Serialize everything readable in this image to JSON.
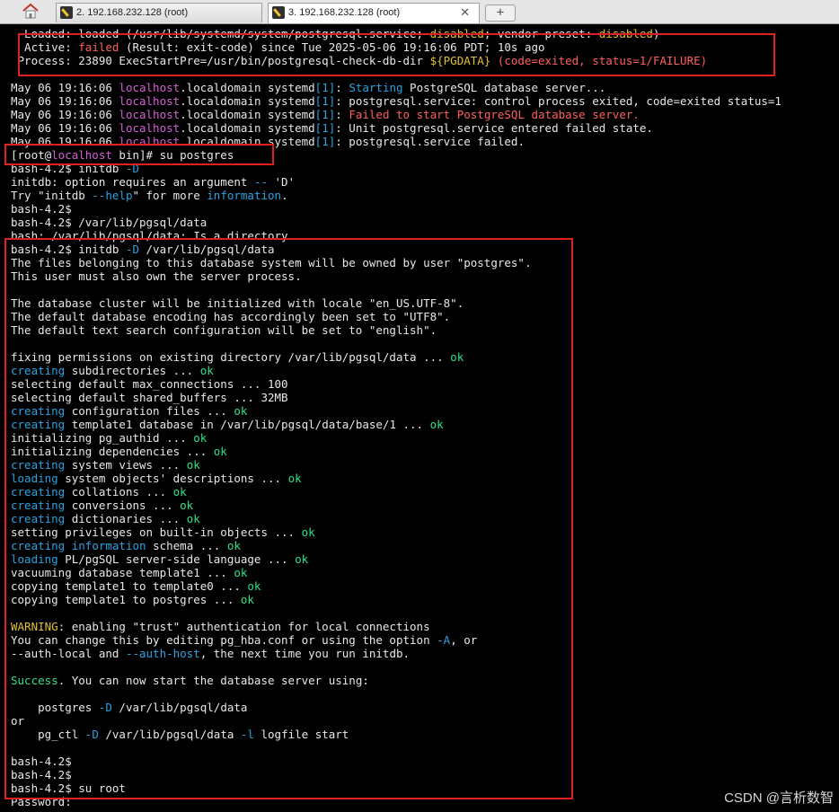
{
  "tabs": [
    {
      "label": "2. 192.168.232.128 (root)"
    },
    {
      "label": "3. 192.168.232.128 (root)",
      "close": "✕"
    }
  ],
  "new_tab": "+",
  "icons": {
    "home": "home-icon",
    "terminal": "terminal-icon"
  },
  "colors": {
    "text": "#e8e8e8",
    "magenta": "#d75fd7",
    "cyan": "#2aa3e0",
    "red": "#ff5f5f",
    "green": "#2ee089",
    "yellow": "#e0c030",
    "highlight_box": "#e0201e"
  },
  "terminal": {
    "lines": [
      [
        [
          "  Loaded: loaded (/usr/lib/systemd/system/postgresql.service; ",
          ""
        ],
        [
          "disabled",
          "yellow"
        ],
        [
          "; vendor preset: ",
          ""
        ],
        [
          "disabled",
          "yellow"
        ],
        [
          ")",
          ""
        ]
      ],
      [
        [
          "  Active: ",
          ""
        ],
        [
          "failed",
          "red"
        ],
        [
          " (Result: exit-code) since Tue 2025-05-06 19:16:06 PDT; 10s ago",
          ""
        ]
      ],
      [
        [
          " Process: 23890 ExecStartPre=/usr/bin/postgresql-check-db-dir ",
          ""
        ],
        [
          "${PGDATA}",
          "yellow"
        ],
        [
          " (code=exited, status=1/FAILURE)",
          "red"
        ]
      ],
      [],
      [
        [
          "May 06 19:16:06 ",
          ""
        ],
        [
          "localhost",
          "magenta"
        ],
        [
          ".localdomain systemd",
          ""
        ],
        [
          "[1]",
          "cyan"
        ],
        [
          ": ",
          ""
        ],
        [
          "Starting",
          "cyan"
        ],
        [
          " PostgreSQL database server...",
          ""
        ]
      ],
      [
        [
          "May 06 19:16:06 ",
          ""
        ],
        [
          "localhost",
          "magenta"
        ],
        [
          ".localdomain systemd",
          ""
        ],
        [
          "[1]",
          "cyan"
        ],
        [
          ": postgresql.service: control process exited, code=exited status=1",
          ""
        ]
      ],
      [
        [
          "May 06 19:16:06 ",
          ""
        ],
        [
          "localhost",
          "magenta"
        ],
        [
          ".localdomain systemd",
          ""
        ],
        [
          "[1]",
          "cyan"
        ],
        [
          ": ",
          ""
        ],
        [
          "Failed to start PostgreSQL database server.",
          "red"
        ]
      ],
      [
        [
          "May 06 19:16:06 ",
          ""
        ],
        [
          "localhost",
          "magenta"
        ],
        [
          ".localdomain systemd",
          ""
        ],
        [
          "[1]",
          "cyan"
        ],
        [
          ": Unit postgresql.service entered failed state.",
          ""
        ]
      ],
      [
        [
          "May 06 19:16:06 ",
          ""
        ],
        [
          "localhost",
          "magenta"
        ],
        [
          ".localdomain systemd",
          ""
        ],
        [
          "[1]",
          "cyan"
        ],
        [
          ": postgresql.service failed.",
          ""
        ]
      ],
      [
        [
          "[root@",
          ""
        ],
        [
          "localhost",
          "magenta"
        ],
        [
          " bin]# su postgres",
          ""
        ]
      ],
      [
        [
          "bash-4.2$ initdb ",
          ""
        ],
        [
          "-D",
          "cyan"
        ]
      ],
      [
        [
          "initdb: option requires an argument ",
          ""
        ],
        [
          "--",
          "cyan"
        ],
        [
          " 'D'",
          ""
        ]
      ],
      [
        [
          "Try \"initdb ",
          ""
        ],
        [
          "--help",
          "cyan"
        ],
        [
          "\" for more ",
          ""
        ],
        [
          "information",
          "cyan"
        ],
        [
          ".",
          ""
        ]
      ],
      [
        [
          "bash-4.2$",
          ""
        ]
      ],
      [
        [
          "bash-4.2$ /var/lib/pgsql/data",
          ""
        ]
      ],
      [
        [
          "bash: /var/lib/pgsql/data: Is a directory",
          ""
        ]
      ],
      [
        [
          "bash-4.2$ initdb ",
          ""
        ],
        [
          "-D",
          "cyan"
        ],
        [
          " /var/lib/pgsql/data",
          ""
        ]
      ],
      [
        [
          "The files belonging to this database system will be owned by user \"postgres\".",
          ""
        ]
      ],
      [
        [
          "This user must also own the server process.",
          ""
        ]
      ],
      [],
      [
        [
          "The database cluster will be initialized with locale \"en_US.UTF-8\".",
          ""
        ]
      ],
      [
        [
          "The default database encoding has accordingly been set to \"UTF8\".",
          ""
        ]
      ],
      [
        [
          "The default text search configuration will be set to \"english\".",
          ""
        ]
      ],
      [],
      [
        [
          "fixing permissions on existing directory /var/lib/pgsql/data ... ",
          ""
        ],
        [
          "ok",
          "green"
        ]
      ],
      [
        [
          "creating",
          "cyan"
        ],
        [
          " subdirectories ... ",
          ""
        ],
        [
          "ok",
          "green"
        ]
      ],
      [
        [
          "selecting default max_connections ... 100",
          ""
        ]
      ],
      [
        [
          "selecting default shared_buffers ... 32MB",
          ""
        ]
      ],
      [
        [
          "creating",
          "cyan"
        ],
        [
          " configuration files ... ",
          ""
        ],
        [
          "ok",
          "green"
        ]
      ],
      [
        [
          "creating",
          "cyan"
        ],
        [
          " template1 database in /var/lib/pgsql/data/base/1 ... ",
          ""
        ],
        [
          "ok",
          "green"
        ]
      ],
      [
        [
          "initializing pg_authid ... ",
          ""
        ],
        [
          "ok",
          "green"
        ]
      ],
      [
        [
          "initializing dependencies ... ",
          ""
        ],
        [
          "ok",
          "green"
        ]
      ],
      [
        [
          "creating",
          "cyan"
        ],
        [
          " system views ... ",
          ""
        ],
        [
          "ok",
          "green"
        ]
      ],
      [
        [
          "loading",
          "cyan"
        ],
        [
          " system objects' descriptions ... ",
          ""
        ],
        [
          "ok",
          "green"
        ]
      ],
      [
        [
          "creating",
          "cyan"
        ],
        [
          " collations ... ",
          ""
        ],
        [
          "ok",
          "green"
        ]
      ],
      [
        [
          "creating",
          "cyan"
        ],
        [
          " conversions ... ",
          ""
        ],
        [
          "ok",
          "green"
        ]
      ],
      [
        [
          "creating",
          "cyan"
        ],
        [
          " dictionaries ... ",
          ""
        ],
        [
          "ok",
          "green"
        ]
      ],
      [
        [
          "setting privileges on built-in objects ... ",
          ""
        ],
        [
          "ok",
          "green"
        ]
      ],
      [
        [
          "creating",
          "cyan"
        ],
        [
          " ",
          ""
        ],
        [
          "information",
          "cyan"
        ],
        [
          " schema ... ",
          ""
        ],
        [
          "ok",
          "green"
        ]
      ],
      [
        [
          "loading",
          "cyan"
        ],
        [
          " PL/pgSQL server-side language ... ",
          ""
        ],
        [
          "ok",
          "green"
        ]
      ],
      [
        [
          "vacuuming database template1 ... ",
          ""
        ],
        [
          "ok",
          "green"
        ]
      ],
      [
        [
          "copying template1 to template0 ... ",
          ""
        ],
        [
          "ok",
          "green"
        ]
      ],
      [
        [
          "copying template1 to postgres ... ",
          ""
        ],
        [
          "ok",
          "green"
        ]
      ],
      [],
      [
        [
          "WARNING",
          "yellow"
        ],
        [
          ": enabling \"trust\" authentication for local connections",
          ""
        ]
      ],
      [
        [
          "You can change this by editing pg_hba.conf or using the option ",
          ""
        ],
        [
          "-A",
          "cyan"
        ],
        [
          ", or",
          ""
        ]
      ],
      [
        [
          "--auth-local and ",
          ""
        ],
        [
          "--auth-host",
          "cyan"
        ],
        [
          ", the next time you run initdb.",
          ""
        ]
      ],
      [],
      [
        [
          "Success",
          "green"
        ],
        [
          ". You can now start the database server using:",
          ""
        ]
      ],
      [],
      [
        [
          "    postgres ",
          ""
        ],
        [
          "-D",
          "cyan"
        ],
        [
          " /var/lib/pgsql/data",
          ""
        ]
      ],
      [
        [
          "or",
          ""
        ]
      ],
      [
        [
          "    pg_ctl ",
          ""
        ],
        [
          "-D",
          "cyan"
        ],
        [
          " /var/lib/pgsql/data ",
          ""
        ],
        [
          "-l",
          "cyan"
        ],
        [
          " logfile start",
          ""
        ]
      ],
      [],
      [
        [
          "bash-4.2$",
          ""
        ]
      ],
      [
        [
          "bash-4.2$",
          ""
        ]
      ],
      [
        [
          "bash-4.2$ su root",
          ""
        ]
      ],
      [
        [
          "Password:",
          ""
        ]
      ]
    ]
  },
  "watermark": "CSDN @言析数智"
}
